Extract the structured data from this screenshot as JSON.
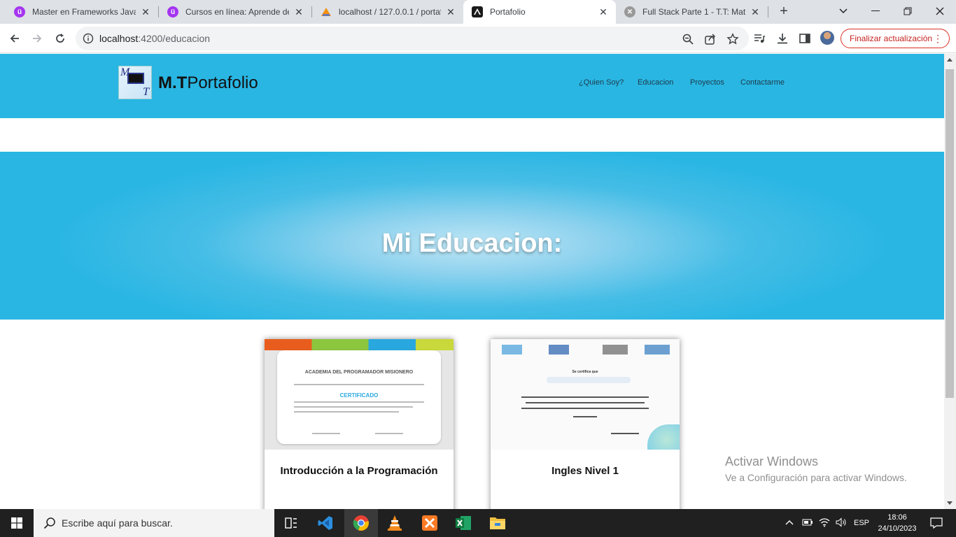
{
  "browser": {
    "tabs": [
      {
        "title": "Master en Frameworks JavaS",
        "icon": "udemy-icon",
        "active": false
      },
      {
        "title": "Cursos en línea: Aprende de",
        "icon": "udemy-icon",
        "active": false
      },
      {
        "title": "localhost / 127.0.0.1 / portaf",
        "icon": "phpmyadmin-icon",
        "active": false
      },
      {
        "title": "Portafolio",
        "icon": "angular-icon",
        "active": true
      },
      {
        "title": "Full Stack Parte 1 - T.T: Mate",
        "icon": "moodle-icon",
        "active": false
      }
    ],
    "url_host": "localhost",
    "url_path": ":4200/educacion",
    "update_label": "Finalizar actualización"
  },
  "site": {
    "brand_bold": "M.T",
    "brand_rest": "Portafolio",
    "logo_m": "M",
    "logo_t": "T",
    "menu": [
      "¿Quien Soy?",
      "Educacion",
      "Proyectos",
      "Contactarme"
    ]
  },
  "hero": {
    "title": "Mi Educacion:"
  },
  "cards": [
    {
      "title": "Introducción a la Programación",
      "cert_heading": "ACADEMIA DEL PROGRAMADOR MISIONERO",
      "cert_label": "CERTIFICADO"
    },
    {
      "title": "Ingles Nivel 1",
      "cert_heading": "Se certifica que"
    }
  ],
  "watermark": {
    "line1": "Activar Windows",
    "line2": "Ve a Configuración para activar Windows."
  },
  "taskbar": {
    "search_placeholder": "Escribe aquí para buscar.",
    "lang": "ESP",
    "time": "18:06",
    "date": "24/10/2023"
  }
}
